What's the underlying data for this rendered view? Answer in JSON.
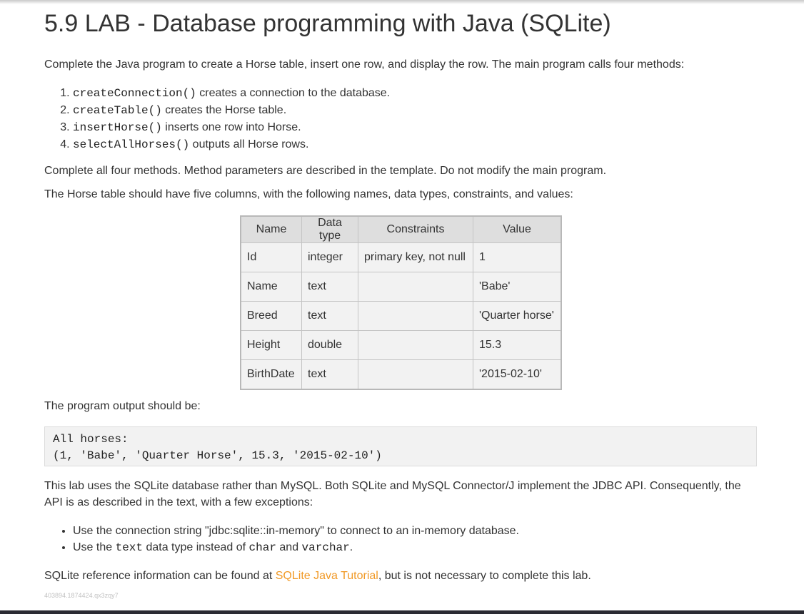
{
  "title": "5.9 LAB - Database programming with Java (SQLite)",
  "intro": "Complete the Java program to create a Horse table, insert one row, and display the row. The main program calls four methods:",
  "steps": [
    {
      "code": "createConnection()",
      "text": " creates a connection to the database."
    },
    {
      "code": "createTable()",
      "text": " creates the Horse table."
    },
    {
      "code": "insertHorse()",
      "text": " inserts one row into Horse."
    },
    {
      "code": "selectAllHorses()",
      "text": " outputs all Horse rows."
    }
  ],
  "para_complete": "Complete all four methods. Method parameters are described in the template. Do not modify the main program.",
  "para_table_intro": "The Horse table should have five columns, with the following names, data types, constraints, and values:",
  "table": {
    "headers": [
      "Name",
      "Data type",
      "Constraints",
      "Value"
    ],
    "rows": [
      [
        "Id",
        "integer",
        "primary key, not null",
        "1"
      ],
      [
        "Name",
        "text",
        "",
        "'Babe'"
      ],
      [
        "Breed",
        "text",
        "",
        "'Quarter horse'"
      ],
      [
        "Height",
        "double",
        "",
        "15.3"
      ],
      [
        "BirthDate",
        "text",
        "",
        "'2015-02-10'"
      ]
    ]
  },
  "output_label": "The program output should be:",
  "output_lines": [
    "All horses:",
    "(1, 'Babe', 'Quarter Horse', 15.3, '2015-02-10')"
  ],
  "para_sqlite": "This lab uses the SQLite database rather than MySQL. Both SQLite and MySQL Connector/J implement the JDBC API. Consequently, the API is as described in the text, with a few exceptions:",
  "bullet1": "Use the connection string \"jdbc:sqlite::in-memory\" to connect to an in-memory database.",
  "bullet2": {
    "pre": "Use the ",
    "code1": "text",
    "mid": " data type instead of ",
    "code2": "char",
    "and": " and ",
    "code3": "varchar",
    "post": "."
  },
  "reference": {
    "pre": "SQLite reference information can be found at ",
    "link": "SQLite Java Tutorial",
    "post": ", but is not necessary to complete this lab."
  },
  "footer_id": "403894.1874424.qx3zqy7",
  "colors": {
    "link": "#f19a27",
    "text": "#333333",
    "table_bg": "#f2f2f2",
    "header_bg": "#dedede"
  }
}
